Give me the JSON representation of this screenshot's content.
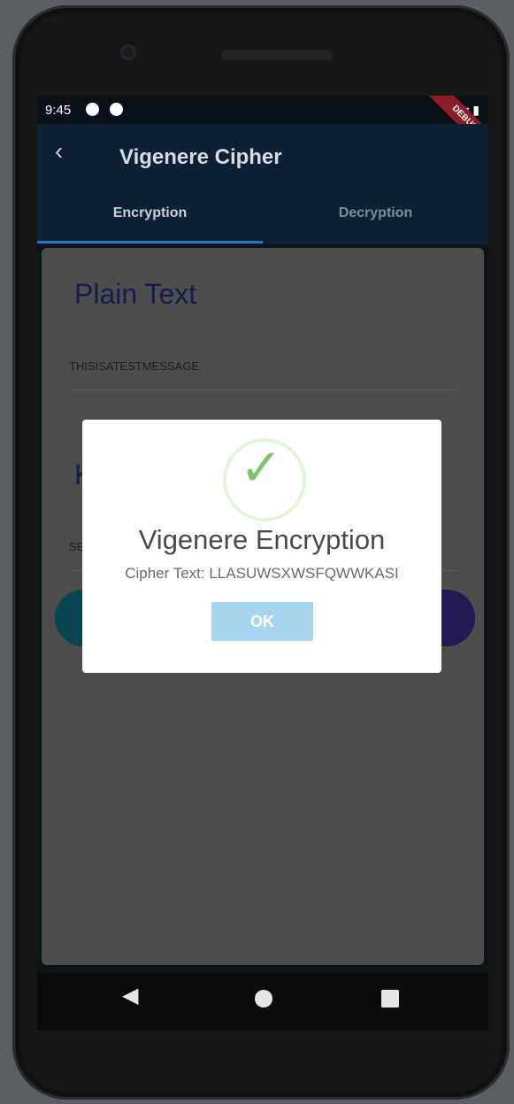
{
  "status": {
    "time": "9:45",
    "debug": "DEBUG"
  },
  "appbar": {
    "title": "Vigenere Cipher",
    "tabs": [
      "Encryption",
      "Decryption"
    ]
  },
  "form": {
    "plain_text_label": "Plain Text",
    "plain_text_value": "THISISATESTMESSAGE",
    "key_label_partial": "K",
    "key_value_partial": "SE"
  },
  "dialog": {
    "title": "Vigenere Encryption",
    "message": "Cipher Text: LLASUWSXWSFQWWKASI",
    "ok": "OK"
  },
  "colors": {
    "appbar": "#0e2134",
    "tab_indicator": "#2c73b9",
    "ok_bg": "#a7d5ef",
    "success": "#7cc56c"
  }
}
